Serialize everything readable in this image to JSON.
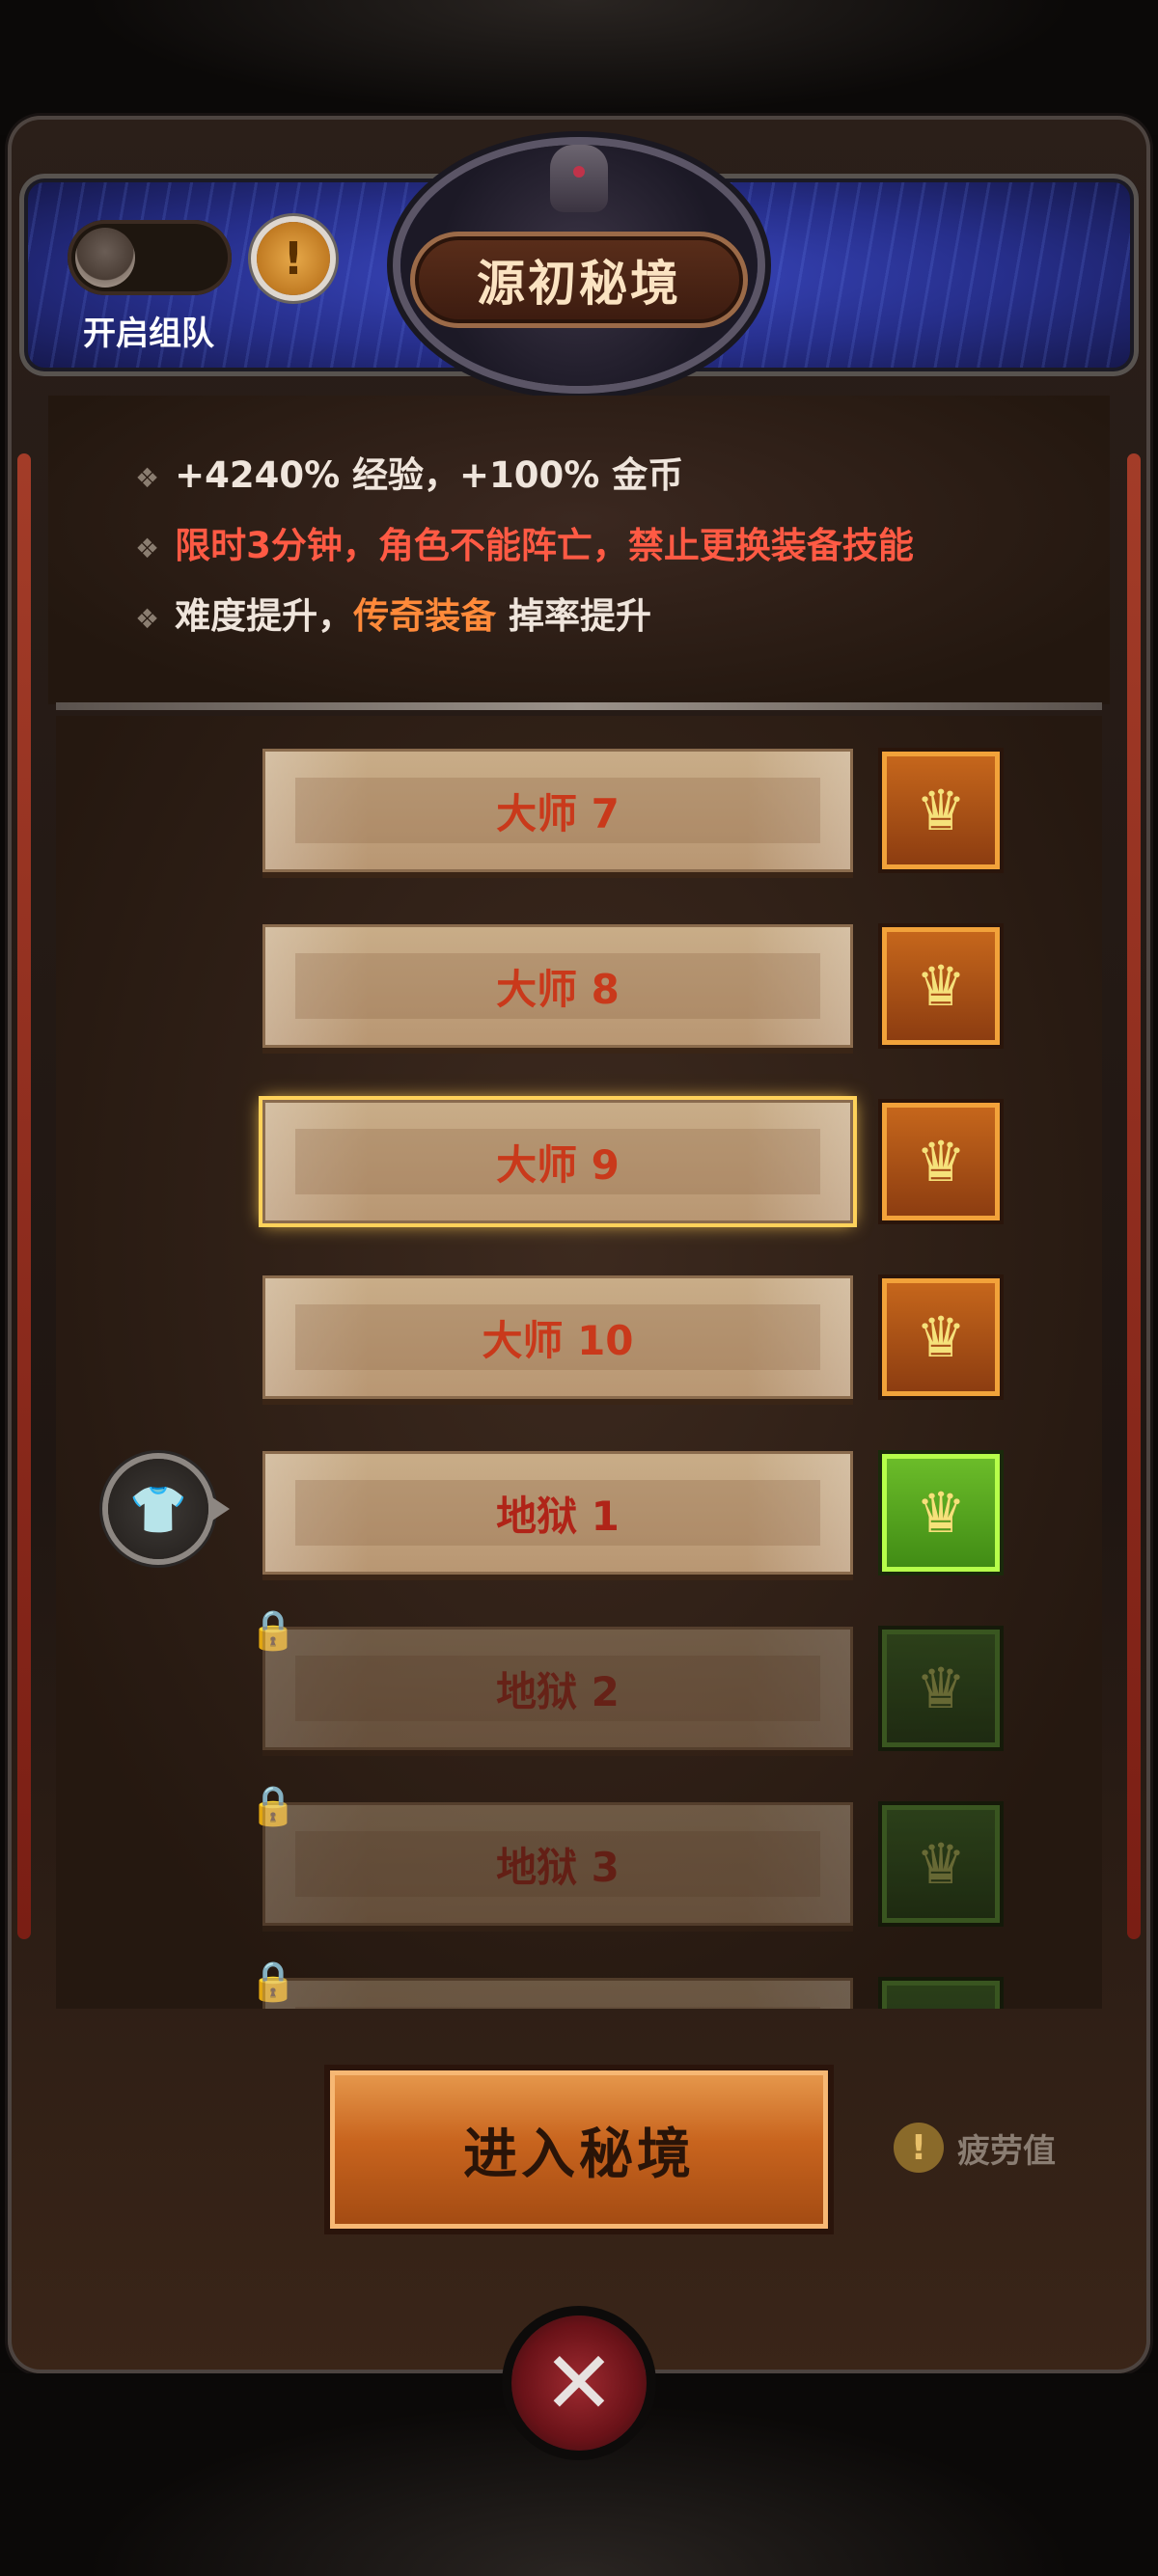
{
  "header": {
    "title": "源初秘境",
    "team_toggle_label": "开启组队",
    "info_icon": "exclamation-icon"
  },
  "rules": [
    {
      "text": "+4240% 经验，+100% 金币"
    },
    {
      "text": "限时3分钟，角色不能阵亡，禁止更换装备技能"
    },
    {
      "prefix": "难度提升，",
      "highlight": "传奇装备",
      "suffix": " 掉率提升"
    }
  ],
  "levels": [
    {
      "label": "大师 7",
      "reward": "gold-chest",
      "selected": false,
      "locked": false
    },
    {
      "label": "大师 8",
      "reward": "gold-chest",
      "selected": false,
      "locked": false
    },
    {
      "label": "大师 9",
      "reward": "gold-chest",
      "selected": true,
      "locked": false
    },
    {
      "label": "大师 10",
      "reward": "gold-chest",
      "selected": false,
      "locked": false
    },
    {
      "label": "地狱 1",
      "reward": "green-chest",
      "selected": false,
      "locked": false,
      "current_marker": "armor-icon"
    },
    {
      "label": "地狱 2",
      "reward": "green-chest",
      "selected": false,
      "locked": true
    },
    {
      "label": "地狱 3",
      "reward": "green-chest",
      "selected": false,
      "locked": true
    }
  ],
  "footer": {
    "enter_button": "进入秘境",
    "fatigue_label": "疲劳值"
  },
  "colors": {
    "master_text": "#c9391b",
    "hell_text": "#b02418",
    "warning_text": "#ff5a44",
    "highlight": "#ff8a3a"
  }
}
